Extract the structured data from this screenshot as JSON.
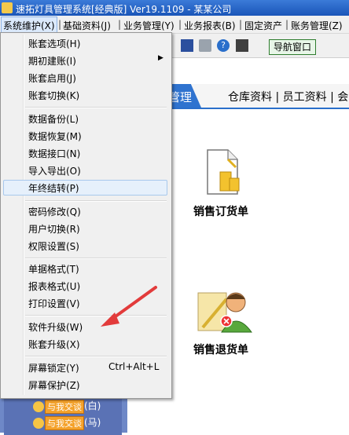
{
  "window": {
    "title": "速拓灯具管理系统[经典版] Ver19.1109 - 某某公司"
  },
  "menubar": {
    "items": [
      "系统维护(X)",
      "基础资料(J)",
      "业务管理(Y)",
      "业务报表(B)",
      "固定资产",
      "账务管理(Z)"
    ]
  },
  "toolbar": {
    "nav_button": "导航窗口"
  },
  "tabs": {
    "active": "管理",
    "rest": "仓库资料 | 员工资料 | 会"
  },
  "modules": {
    "order": "销售订货单",
    "return": "销售退货单"
  },
  "qq": {
    "tag": "与我交谈",
    "rows": [
      "(白)",
      "(马)"
    ]
  },
  "dropdown": {
    "items": [
      {
        "label": "账套选项(H)"
      },
      {
        "label": "期初建账(I)",
        "submenu": true
      },
      {
        "label": "账套启用(J)"
      },
      {
        "label": "账套切换(K)"
      },
      {
        "label": "数据备份(L)"
      },
      {
        "label": "数据恢复(M)"
      },
      {
        "label": "数据接口(N)"
      },
      {
        "label": "导入导出(O)"
      },
      {
        "label": "年终结转(P)",
        "highlighted": true
      },
      {
        "label": "密码修改(Q)"
      },
      {
        "label": "用户切换(R)"
      },
      {
        "label": "权限设置(S)"
      },
      {
        "label": "单据格式(T)"
      },
      {
        "label": "报表格式(U)"
      },
      {
        "label": "打印设置(V)"
      },
      {
        "label": "软件升级(W)"
      },
      {
        "label": "账套升级(X)"
      },
      {
        "label": "屏幕锁定(Y)",
        "shortcut": "Ctrl+Alt+L"
      },
      {
        "label": "屏幕保护(Z)"
      }
    ]
  },
  "colors": {
    "accent": "#2f73cf",
    "annotation_arrow": "#e23b3b"
  }
}
